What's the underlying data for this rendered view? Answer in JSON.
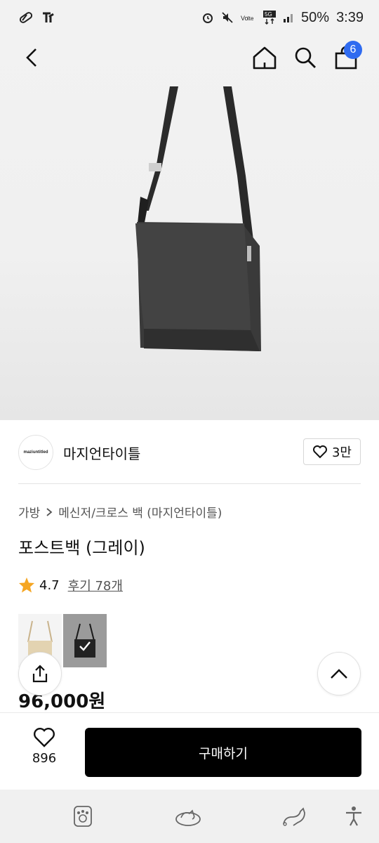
{
  "status": {
    "battery": "50%",
    "time": "3:39",
    "network": "5G"
  },
  "nav": {
    "cart_count": "6"
  },
  "brand": {
    "logo_text": "maziuntitled",
    "name": "마지언타이틀",
    "likes": "3만"
  },
  "breadcrumb": {
    "category": "가방",
    "subcategory": "메신저/크로스 백 (마지언타이틀)"
  },
  "product": {
    "title": "포스트백 (그레이)",
    "rating": "4.7",
    "reviews": "후기 78개",
    "price": "96,000원"
  },
  "bottom_bar": {
    "wish_count": "896",
    "buy_label": "구매하기"
  },
  "colors": {
    "accent_badge": "#2f6bf0",
    "star": "#f5a623",
    "buy_bg": "#000000"
  }
}
